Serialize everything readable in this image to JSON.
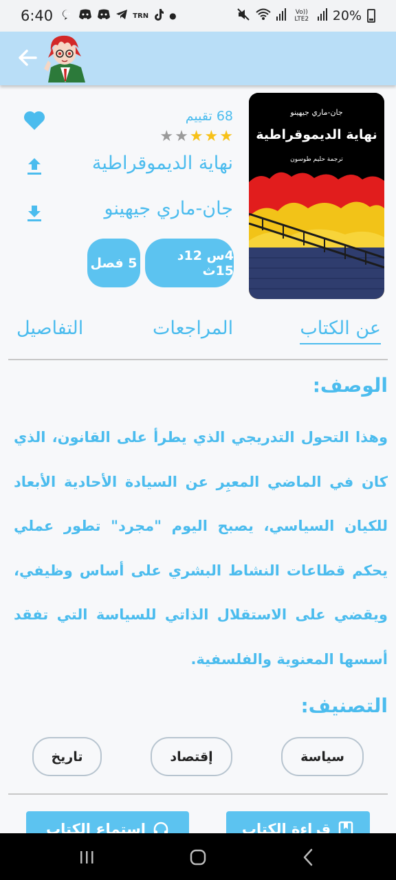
{
  "status_bar": {
    "time": "6:40",
    "battery": "20%",
    "icons": [
      "message-icon",
      "discord-icon",
      "discord-icon",
      "telegram-icon",
      "trn-icon",
      "tiktok-icon",
      "dot-icon"
    ],
    "trn_label": "TRN",
    "network_label": "Vo)) LTE2"
  },
  "app_bar": {
    "back_icon": "arrow-back-icon",
    "avatar": "anime-character-avatar"
  },
  "book": {
    "cover": {
      "author": "جان-ماري جيهينو",
      "title": "نهاية الديموقراطية",
      "translator": "ترجمة حليم طوسون"
    },
    "rating_count": "68 تقييم",
    "rating": 3,
    "rating_max": 5,
    "title": "نهاية الديموقراطية",
    "author": "جان-ماري جيهينو",
    "duration": "4س 12د 15ث",
    "chapters": "5 فصل"
  },
  "tabs": {
    "about": "عن الكتاب",
    "reviews": "المراجعات",
    "details": "التفاصيل",
    "active": "about"
  },
  "description": {
    "heading": "الوصف:",
    "body": "وهذا التحول التدريجي الذي يطرأ على القانون، الذي كان في الماضي المعبِر عن السيادة الأحادية الأبعاد للكيان السياسي، يصبح اليوم \"مجرد\" تطور عملي يحكم قطاعات النشاط البشري على أساس وظيفي، ويقضي على الاستقلال الذاتي للسياسة التي تفقد أسسها المعنوية والفلسفية."
  },
  "categories": {
    "heading": "التصنيف:",
    "items": [
      "سياسة",
      "إقتصاد",
      "تاريخ"
    ]
  },
  "actions": {
    "read": "قراءة الكتاب",
    "listen": "استماع الكتاب"
  },
  "colors": {
    "accent": "#4bbcee",
    "chip": "#5cc3f0",
    "app_bar": "#b9def7",
    "star": "#f7c118"
  }
}
